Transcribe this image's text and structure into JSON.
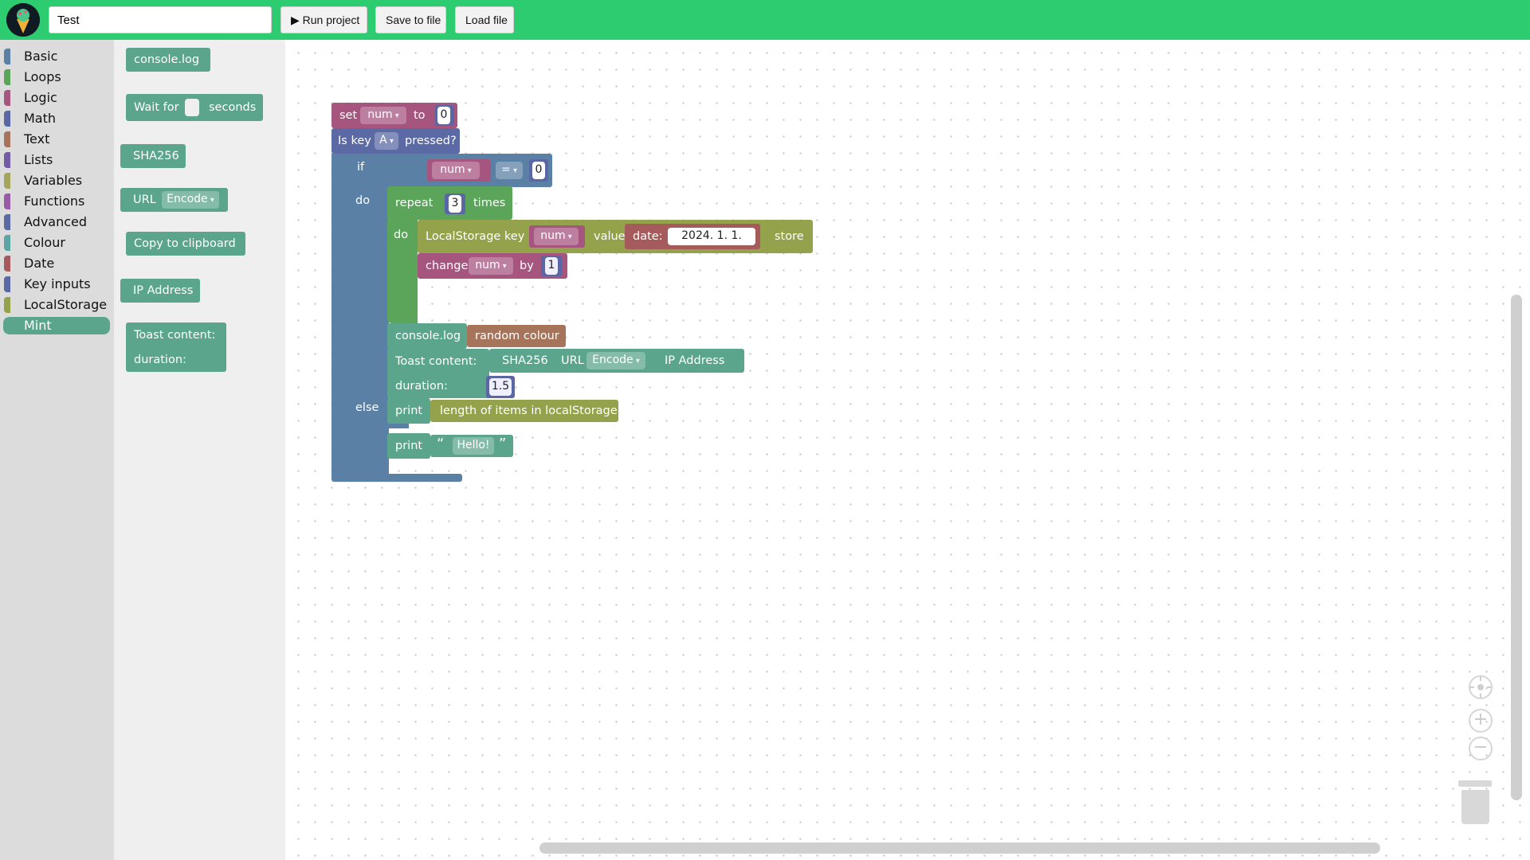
{
  "topbar": {
    "project_name": "Test",
    "run_label": "▶ Run project",
    "save_label": "Save to file",
    "load_label": "Load file"
  },
  "categories": [
    {
      "label": "Basic",
      "color": "#5b80a5"
    },
    {
      "label": "Loops",
      "color": "#5ba55b"
    },
    {
      "label": "Logic",
      "color": "#a5577f"
    },
    {
      "label": "Math",
      "color": "#5b67a5"
    },
    {
      "label": "Text",
      "color": "#a5745b"
    },
    {
      "label": "Lists",
      "color": "#745ba5"
    },
    {
      "label": "Variables",
      "color": "#a5a55b"
    },
    {
      "label": "Functions",
      "color": "#995ba5"
    },
    {
      "label": "Advanced",
      "color": "#5b6aa5"
    },
    {
      "label": "Colour",
      "color": "#5ba5a5"
    },
    {
      "label": "Date",
      "color": "#a55b5b"
    },
    {
      "label": "Key inputs",
      "color": "#5b6aa5"
    },
    {
      "label": "LocalStorage",
      "color": "#94a34b"
    },
    {
      "label": "Mint",
      "color": "#5ba58c",
      "selected": true
    }
  ],
  "flyout": {
    "console_log": "console.log",
    "wait_for": "Wait for",
    "seconds": "seconds",
    "sha256": "SHA256",
    "url": "URL",
    "encode": "Encode",
    "copy_clipboard": "Copy to clipboard",
    "ip_address": "IP Address",
    "toast_content": "Toast content:",
    "duration": "duration:"
  },
  "program": {
    "set": "set",
    "set_var": "num",
    "to": "to",
    "set_value": "0",
    "is_key": "Is key",
    "key": "A",
    "pressed": "pressed?",
    "if": "if",
    "do": "do",
    "else": "else",
    "cmp_var": "num",
    "cmp_op": "=",
    "cmp_value": "0",
    "repeat": "repeat",
    "repeat_count": "3",
    "times": "times",
    "ls_key": "LocalStorage key",
    "ls_key_var": "num",
    "ls_value": "value",
    "date_label": "date:",
    "date_value": "2024. 1. 1.",
    "store": "store",
    "change": "change",
    "change_var": "num",
    "by": "by",
    "change_value": "1",
    "console_log": "console.log",
    "random_colour": "random colour",
    "toast_content": "Toast content:",
    "sha256": "SHA256",
    "url": "URL",
    "encode": "Encode",
    "ip_address": "IP Address",
    "duration": "duration:",
    "duration_value": "1.5",
    "print": "print",
    "length_ls": "length of items in localStorage",
    "print2": "print",
    "open_quote": "“",
    "hello": "Hello!",
    "close_quote": "”"
  },
  "icons": {
    "logo": "ice-cream-logo",
    "recenter": "target-icon",
    "zoom_in": "plus-icon",
    "zoom_out": "minus-icon",
    "trash": "trash-icon"
  }
}
